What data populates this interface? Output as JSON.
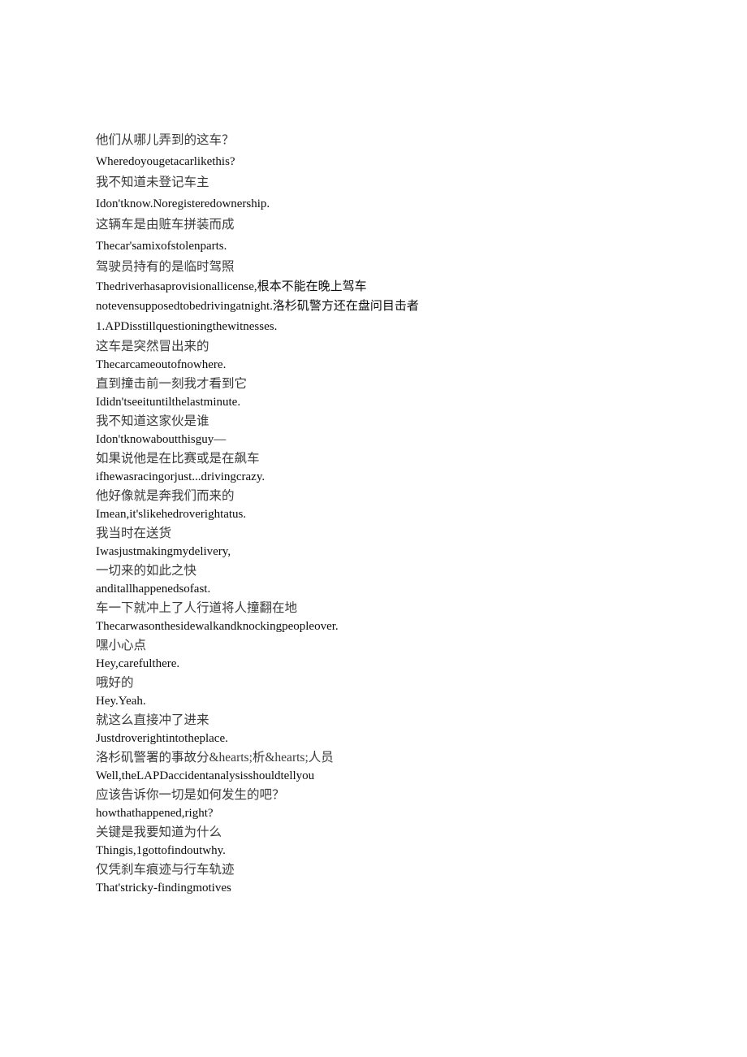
{
  "document": {
    "page_background": "#ffffff",
    "text_color_cn": "#3a3a3a",
    "text_color_en": "#0d0d0d",
    "blocks": [
      {
        "id": "block-1",
        "spacing": "loose",
        "lines": [
          {
            "lang": "zh",
            "text": "他们从哪儿弄到的这车？"
          },
          {
            "lang": "en",
            "text": "Wheredoyougetacarlikethis?"
          },
          {
            "lang": "zh",
            "text": "我不知道未登记车主"
          },
          {
            "lang": "en",
            "text": "Idon'tknow.Noregisteredownership."
          },
          {
            "lang": "zh",
            "text": "这辆车是由赃车拼装而成"
          },
          {
            "lang": "en",
            "text": "Thecar'samixofstolenparts."
          },
          {
            "lang": "zh",
            "text": "驾驶员持有的是临时驾照"
          },
          {
            "lang": "mixed",
            "wrap": true,
            "text": "Thedriverhasaprovisionallicense,根本不能在晚上驾车notevensupposedtobedrivingatnight.洛杉矶警方还在盘问目击者"
          },
          {
            "lang": "en",
            "text": "1.APDisstillquestioningthewitnesses."
          }
        ]
      },
      {
        "id": "block-2",
        "spacing": "tight",
        "lines": [
          {
            "lang": "zh",
            "text": "这车是突然冒出来的"
          },
          {
            "lang": "en",
            "text": "Thecarcameoutofnowhere."
          },
          {
            "lang": "zh",
            "text": "直到撞击前一刻我才看到它"
          },
          {
            "lang": "en",
            "text": "Ididn'tseeituntilthelastminute."
          },
          {
            "lang": "zh",
            "text": "我不知道这家伙是谁"
          },
          {
            "lang": "en",
            "text": "Idon'tknowaboutthisguy—"
          },
          {
            "lang": "zh",
            "text": "如果说他是在比赛或是在飙车"
          },
          {
            "lang": "en",
            "text": "ifhewasracingorjust...drivingcrazy."
          },
          {
            "lang": "zh",
            "text": "他好像就是奔我们而来的"
          },
          {
            "lang": "en",
            "text": "Imean,it'slikehedroverightatus."
          },
          {
            "lang": "zh",
            "text": "我当时在送货"
          },
          {
            "lang": "en",
            "text": "Iwasjustmakingmydelivery,"
          },
          {
            "lang": "zh",
            "text": "一切来的如此之快"
          },
          {
            "lang": "en",
            "text": "anditallhappenedsofast."
          },
          {
            "lang": "zh",
            "text": "车一下就冲上了人行道将人撞翻在地"
          },
          {
            "lang": "en",
            "text": "Thecarwasonthesidewalkandknockingpeopleover."
          },
          {
            "lang": "zh",
            "text": "嘿小心点"
          },
          {
            "lang": "en",
            "text": "Hey,carefulthere."
          },
          {
            "lang": "zh",
            "text": "哦好的"
          },
          {
            "lang": "en",
            "text": "Hey.Yeah."
          },
          {
            "lang": "zh",
            "text": "就这么直接冲了进来"
          },
          {
            "lang": "en",
            "text": "Justdroverightintotheplace."
          },
          {
            "lang": "zh",
            "text": "洛杉矶警署的事故分&hearts;析&hearts;人员"
          },
          {
            "lang": "en",
            "text": "Well,theLAPDaccidentanalysisshouldtellyou"
          },
          {
            "lang": "zh",
            "text": "应该告诉你一切是如何发生的吧？"
          },
          {
            "lang": "en",
            "text": "howthathappened,right?"
          },
          {
            "lang": "zh",
            "text": "关键是我要知道为什么"
          },
          {
            "lang": "en",
            "text": "Thingis,1gottofindoutwhy."
          },
          {
            "lang": "zh",
            "text": "仅凭刹车痕迹与行车轨迹"
          },
          {
            "lang": "en",
            "text": "That'stricky-findingmotives"
          }
        ]
      }
    ]
  }
}
